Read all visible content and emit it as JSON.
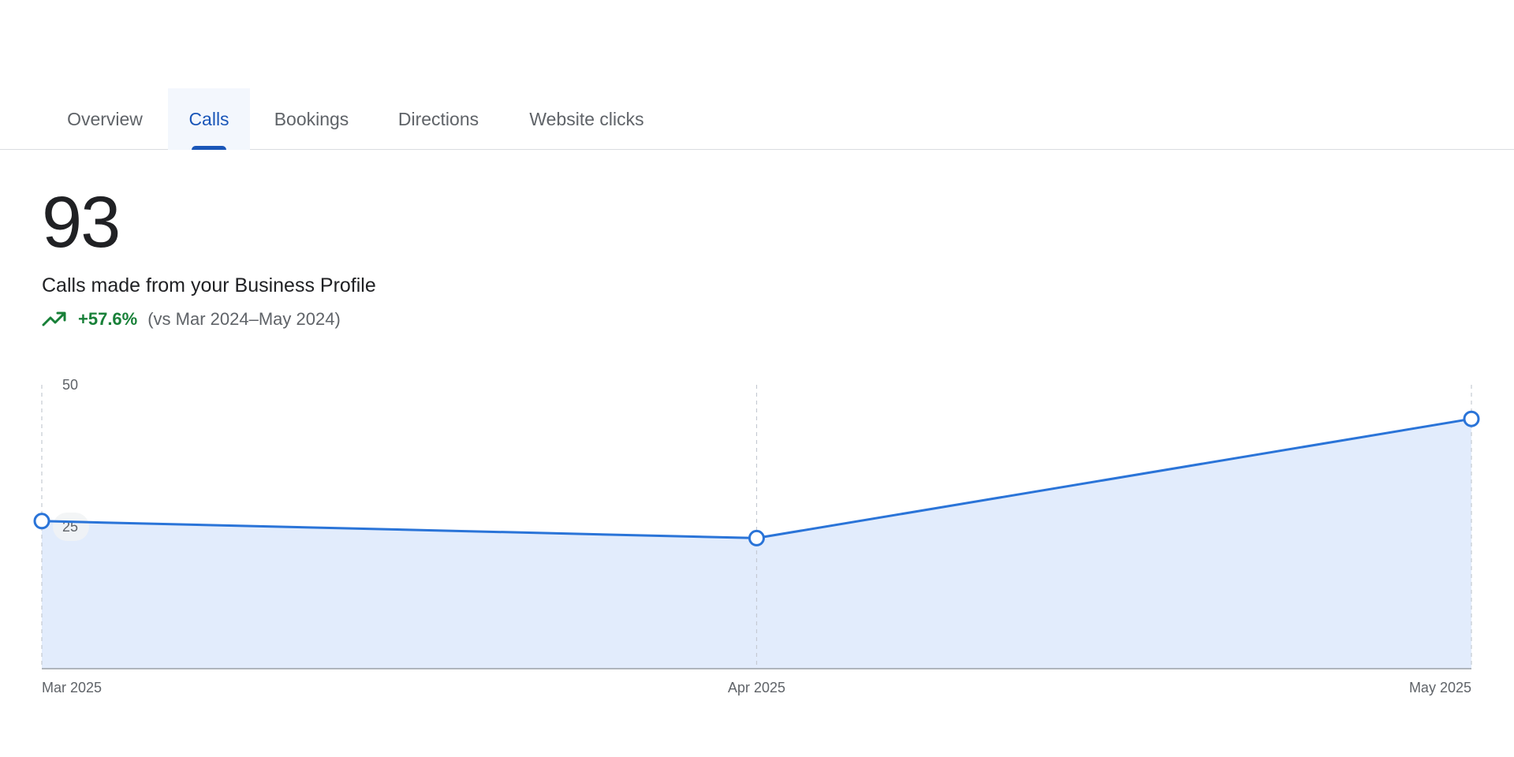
{
  "tabs": [
    {
      "label": "Overview",
      "active": false
    },
    {
      "label": "Calls",
      "active": true
    },
    {
      "label": "Bookings",
      "active": false
    },
    {
      "label": "Directions",
      "active": false
    },
    {
      "label": "Website clicks",
      "active": false
    }
  ],
  "metric": {
    "value": "93",
    "label": "Calls made from your Business Profile",
    "change": "+57.6%",
    "comparison": "(vs Mar 2024–May 2024)",
    "trend_icon": "trending-up-icon"
  },
  "colors": {
    "accent": "#1a56b8",
    "line": "#2a74d8",
    "area": "#e2ecfc",
    "positive": "#188038"
  },
  "chart_data": {
    "type": "area",
    "categories": [
      "Mar 2025",
      "Apr 2025",
      "May 2025"
    ],
    "values": [
      26,
      23,
      44
    ],
    "y_ticks": [
      25,
      50
    ],
    "ylim": [
      0,
      50
    ],
    "grid": "vertical-dashed"
  }
}
